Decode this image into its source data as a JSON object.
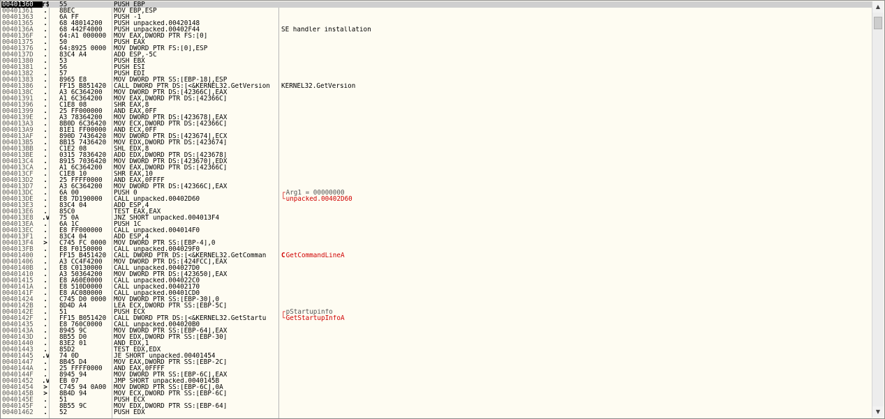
{
  "rows": [
    {
      "addr": "00401360",
      "mark": "r$",
      "hex": "55",
      "dis": "PUSH EBP",
      "com": "",
      "sel": true
    },
    {
      "addr": "00401361",
      "mark": ".",
      "hex": "8BEC",
      "dis": "MOV EBP,ESP",
      "com": ""
    },
    {
      "addr": "00401363",
      "mark": ".",
      "hex": "6A FF",
      "dis": "PUSH -1",
      "com": ""
    },
    {
      "addr": "00401365",
      "mark": ".",
      "hex": "68 48014200",
      "dis": "PUSH unpacked.00420148",
      "com": ""
    },
    {
      "addr": "0040136A",
      "mark": ".",
      "hex": "68 442F4000",
      "dis": "PUSH unpacked.00402F44",
      "com": "SE handler installation"
    },
    {
      "addr": "0040136F",
      "mark": ".",
      "hex": "64:A1 000000",
      "dis": "MOV EAX,DWORD PTR FS:[0]",
      "com": ""
    },
    {
      "addr": "00401375",
      "mark": ".",
      "hex": "50",
      "dis": "PUSH EAX",
      "com": ""
    },
    {
      "addr": "00401376",
      "mark": ".",
      "hex": "64:8925 0000",
      "dis": "MOV DWORD PTR FS:[0],ESP",
      "com": ""
    },
    {
      "addr": "0040137D",
      "mark": ".",
      "hex": "83C4 A4",
      "dis": "ADD ESP,-5C",
      "com": ""
    },
    {
      "addr": "00401380",
      "mark": ".",
      "hex": "53",
      "dis": "PUSH EBX",
      "com": ""
    },
    {
      "addr": "00401381",
      "mark": ".",
      "hex": "56",
      "dis": "PUSH ESI",
      "com": ""
    },
    {
      "addr": "00401382",
      "mark": ".",
      "hex": "57",
      "dis": "PUSH EDI",
      "com": ""
    },
    {
      "addr": "00401383",
      "mark": ".",
      "hex": "8965 E8",
      "dis": "MOV DWORD PTR SS:[EBP-18],ESP",
      "com": ""
    },
    {
      "addr": "00401386",
      "mark": ".",
      "hex": "FF15 B851420",
      "dis": "CALL DWORD PTR DS:[<&KERNEL32.GetVersion",
      "com": "KERNEL32.GetVersion"
    },
    {
      "addr": "0040138C",
      "mark": ".",
      "hex": "A3 6C364200",
      "dis": "MOV DWORD PTR DS:[42366C],EAX",
      "com": ""
    },
    {
      "addr": "00401391",
      "mark": ".",
      "hex": "A1 6C364200",
      "dis": "MOV EAX,DWORD PTR DS:[42366C]",
      "com": ""
    },
    {
      "addr": "00401396",
      "mark": ".",
      "hex": "C1E8 08",
      "dis": "SHR EAX,8",
      "com": ""
    },
    {
      "addr": "00401399",
      "mark": ".",
      "hex": "25 FF000000",
      "dis": "AND EAX,0FF",
      "com": ""
    },
    {
      "addr": "0040139E",
      "mark": ".",
      "hex": "A3 78364200",
      "dis": "MOV DWORD PTR DS:[423678],EAX",
      "com": ""
    },
    {
      "addr": "004013A3",
      "mark": ".",
      "hex": "8B0D 6C36420",
      "dis": "MOV ECX,DWORD PTR DS:[42366C]",
      "com": ""
    },
    {
      "addr": "004013A9",
      "mark": ".",
      "hex": "81E1 FF00000",
      "dis": "AND ECX,0FF",
      "com": ""
    },
    {
      "addr": "004013AF",
      "mark": ".",
      "hex": "890D 7436420",
      "dis": "MOV DWORD PTR DS:[423674],ECX",
      "com": ""
    },
    {
      "addr": "004013B5",
      "mark": ".",
      "hex": "8B15 7436420",
      "dis": "MOV EDX,DWORD PTR DS:[423674]",
      "com": ""
    },
    {
      "addr": "004013BB",
      "mark": ".",
      "hex": "C1E2 08",
      "dis": "SHL EDX,8",
      "com": ""
    },
    {
      "addr": "004013BE",
      "mark": ".",
      "hex": "0315 7836420",
      "dis": "ADD EDX,DWORD PTR DS:[423678]",
      "com": ""
    },
    {
      "addr": "004013C4",
      "mark": ".",
      "hex": "8915 7036420",
      "dis": "MOV DWORD PTR DS:[423670],EDX",
      "com": ""
    },
    {
      "addr": "004013CA",
      "mark": ".",
      "hex": "A1 6C364200",
      "dis": "MOV EAX,DWORD PTR DS:[42366C]",
      "com": ""
    },
    {
      "addr": "004013CF",
      "mark": ".",
      "hex": "C1E8 10",
      "dis": "SHR EAX,10",
      "com": ""
    },
    {
      "addr": "004013D2",
      "mark": ".",
      "hex": "25 FFFF0000",
      "dis": "AND EAX,0FFFF",
      "com": ""
    },
    {
      "addr": "004013D7",
      "mark": ".",
      "hex": "A3 6C364200",
      "dis": "MOV DWORD PTR DS:[42366C],EAX",
      "com": ""
    },
    {
      "addr": "004013DC",
      "mark": ".",
      "hex": "6A 00",
      "dis": "PUSH 0",
      "com": "Arg1 = 00000000",
      "brk": "┌",
      "color": "gray"
    },
    {
      "addr": "004013DE",
      "mark": ".",
      "hex": "E8 7D190000",
      "dis": "CALL unpacked.00402D60",
      "com": "unpacked.00402D60",
      "brk": "└",
      "color": "red"
    },
    {
      "addr": "004013E3",
      "mark": ".",
      "hex": "83C4 04",
      "dis": "ADD ESP,4",
      "com": ""
    },
    {
      "addr": "004013E6",
      "mark": ".",
      "hex": "85C0",
      "dis": "TEST EAX,EAX",
      "com": ""
    },
    {
      "addr": "004013E8",
      "mark": ".v",
      "hex": "75 0A",
      "dis": "JNZ SHORT unpacked.004013F4",
      "com": ""
    },
    {
      "addr": "004013EA",
      "mark": ".",
      "hex": "6A 1C",
      "dis": "PUSH 1C",
      "com": ""
    },
    {
      "addr": "004013EC",
      "mark": ".",
      "hex": "E8 FF000000",
      "dis": "CALL unpacked.004014F0",
      "com": ""
    },
    {
      "addr": "004013F1",
      "mark": ".",
      "hex": "83C4 04",
      "dis": "ADD ESP,4",
      "com": ""
    },
    {
      "addr": "004013F4",
      "mark": ">",
      "hex": "C745 FC 0000",
      "dis": "MOV DWORD PTR SS:[EBP-4],0",
      "com": ""
    },
    {
      "addr": "004013FB",
      "mark": ".",
      "hex": "E8 F0150000",
      "dis": "CALL unpacked.004029F0",
      "com": ""
    },
    {
      "addr": "00401400",
      "mark": ".",
      "hex": "FF15 B451420",
      "dis": "CALL DWORD PTR DS:[<&KERNEL32.GetComman",
      "com": "GetCommandLineA",
      "brk": "C",
      "color": "red"
    },
    {
      "addr": "00401406",
      "mark": ".",
      "hex": "A3 CC4F4200",
      "dis": "MOV DWORD PTR DS:[424FCC],EAX",
      "com": ""
    },
    {
      "addr": "0040140B",
      "mark": ".",
      "hex": "E8 C0130000",
      "dis": "CALL unpacked.004027D0",
      "com": ""
    },
    {
      "addr": "00401410",
      "mark": ".",
      "hex": "A3 50364200",
      "dis": "MOV DWORD PTR DS:[423650],EAX",
      "com": ""
    },
    {
      "addr": "00401415",
      "mark": ".",
      "hex": "E8 A60E0000",
      "dis": "CALL unpacked.004022C0",
      "com": ""
    },
    {
      "addr": "0040141A",
      "mark": ".",
      "hex": "E8 510D0000",
      "dis": "CALL unpacked.00402170",
      "com": ""
    },
    {
      "addr": "0040141F",
      "mark": ".",
      "hex": "E8 AC080000",
      "dis": "CALL unpacked.00401CD0",
      "com": ""
    },
    {
      "addr": "00401424",
      "mark": ".",
      "hex": "C745 D0 0000",
      "dis": "MOV DWORD PTR SS:[EBP-30],0",
      "com": ""
    },
    {
      "addr": "0040142B",
      "mark": ".",
      "hex": "8D4D A4",
      "dis": "LEA ECX,DWORD PTR SS:[EBP-5C]",
      "com": ""
    },
    {
      "addr": "0040142E",
      "mark": ".",
      "hex": "51",
      "dis": "PUSH ECX",
      "com": "pStartupinfo",
      "brk": "┌",
      "color": "gray"
    },
    {
      "addr": "0040142F",
      "mark": ".",
      "hex": "FF15 B051420",
      "dis": "CALL DWORD PTR DS:[<&KERNEL32.GetStartu",
      "com": "GetStartupInfoA",
      "brk": "└",
      "color": "red"
    },
    {
      "addr": "00401435",
      "mark": ".",
      "hex": "E8 760C0000",
      "dis": "CALL unpacked.004020B0",
      "com": ""
    },
    {
      "addr": "0040143A",
      "mark": ".",
      "hex": "8945 9C",
      "dis": "MOV DWORD PTR SS:[EBP-64],EAX",
      "com": ""
    },
    {
      "addr": "0040143D",
      "mark": ".",
      "hex": "8B55 D0",
      "dis": "MOV EDX,DWORD PTR SS:[EBP-30]",
      "com": ""
    },
    {
      "addr": "00401440",
      "mark": ".",
      "hex": "83E2 01",
      "dis": "AND EDX,1",
      "com": ""
    },
    {
      "addr": "00401443",
      "mark": ".",
      "hex": "85D2",
      "dis": "TEST EDX,EDX",
      "com": ""
    },
    {
      "addr": "00401445",
      "mark": ".v",
      "hex": "74 0D",
      "dis": "JE SHORT unpacked.00401454",
      "com": ""
    },
    {
      "addr": "00401447",
      "mark": ".",
      "hex": "8B45 D4",
      "dis": "MOV EAX,DWORD PTR SS:[EBP-2C]",
      "com": ""
    },
    {
      "addr": "0040144A",
      "mark": ".",
      "hex": "25 FFFF0000",
      "dis": "AND EAX,0FFFF",
      "com": ""
    },
    {
      "addr": "0040144F",
      "mark": ".",
      "hex": "8945 94",
      "dis": "MOV DWORD PTR SS:[EBP-6C],EAX",
      "com": ""
    },
    {
      "addr": "00401452",
      "mark": ".v",
      "hex": "EB 07",
      "dis": "JMP SHORT unpacked.0040145B",
      "com": ""
    },
    {
      "addr": "00401454",
      "mark": ">",
      "hex": "C745 94 0A00",
      "dis": "MOV DWORD PTR SS:[EBP-6C],0A",
      "com": ""
    },
    {
      "addr": "0040145B",
      "mark": ">",
      "hex": "8B4D 94",
      "dis": "MOV ECX,DWORD PTR SS:[EBP-6C]",
      "com": ""
    },
    {
      "addr": "0040145E",
      "mark": ".",
      "hex": "51",
      "dis": "PUSH ECX",
      "com": ""
    },
    {
      "addr": "0040145F",
      "mark": ".",
      "hex": "8B55 9C",
      "dis": "MOV EDX,DWORD PTR SS:[EBP-64]",
      "com": ""
    },
    {
      "addr": "00401462",
      "mark": ".",
      "hex": "52",
      "dis": "PUSH EDX",
      "com": ""
    }
  ],
  "scrollbar": {
    "up_icon": "▲",
    "down_icon": "▼"
  }
}
